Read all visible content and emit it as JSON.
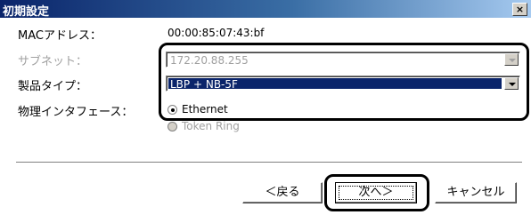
{
  "window": {
    "title": "初期設定",
    "close_label": "×"
  },
  "mac": {
    "label": "MACアドレス：",
    "value": "00:00:85:07:43:bf"
  },
  "subnet": {
    "label": "サブネット：",
    "value": "172.20.88.255",
    "enabled": false
  },
  "product_type": {
    "label": "製品タイプ：",
    "value": "LBP + NB-5F",
    "enabled": true
  },
  "interface": {
    "label": "物理インタフェース：",
    "options": [
      {
        "label": "Ethernet",
        "checked": true,
        "enabled": true
      },
      {
        "label": "Token Ring",
        "checked": false,
        "enabled": false
      }
    ]
  },
  "buttons": {
    "back": "＜戻る",
    "next": "次へ＞",
    "cancel": "キャンセル"
  },
  "colors": {
    "titlebar_start": "#0a246a",
    "selection": "#0a246a",
    "callout": "#000000"
  }
}
